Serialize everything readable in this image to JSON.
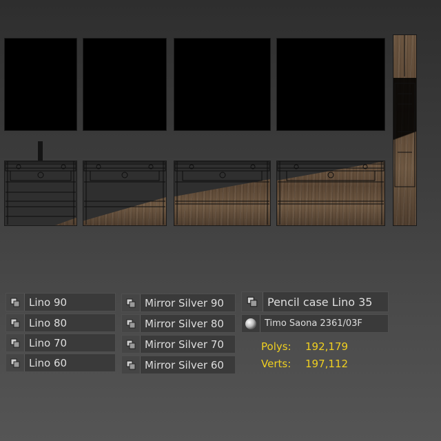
{
  "left_list": [
    {
      "label": "Lino 90",
      "icon": "object-icon"
    },
    {
      "label": "Lino 80",
      "icon": "object-icon"
    },
    {
      "label": "Lino 70",
      "icon": "object-icon"
    },
    {
      "label": "Lino 60",
      "icon": "object-icon"
    }
  ],
  "mid_list": [
    {
      "label": "Mirror Silver 90",
      "icon": "object-icon"
    },
    {
      "label": "Mirror Silver 80",
      "icon": "object-icon"
    },
    {
      "label": "Mirror Silver 70",
      "icon": "object-icon"
    },
    {
      "label": "Mirror Silver 60",
      "icon": "object-icon"
    }
  ],
  "right_panel": {
    "object_name": "Pencil case Lino 35",
    "object_icon": "object-icon",
    "material_name": "Timo Saona 2361/03F",
    "material_icon": "material-sphere-icon"
  },
  "stats": {
    "polys_label": "Polys:",
    "polys_value": "192,179",
    "verts_label": "Verts:",
    "verts_value": "197,112"
  },
  "colors": {
    "stats_text": "#f0d020",
    "wood": "#6b5540",
    "mirror": "#000000"
  }
}
